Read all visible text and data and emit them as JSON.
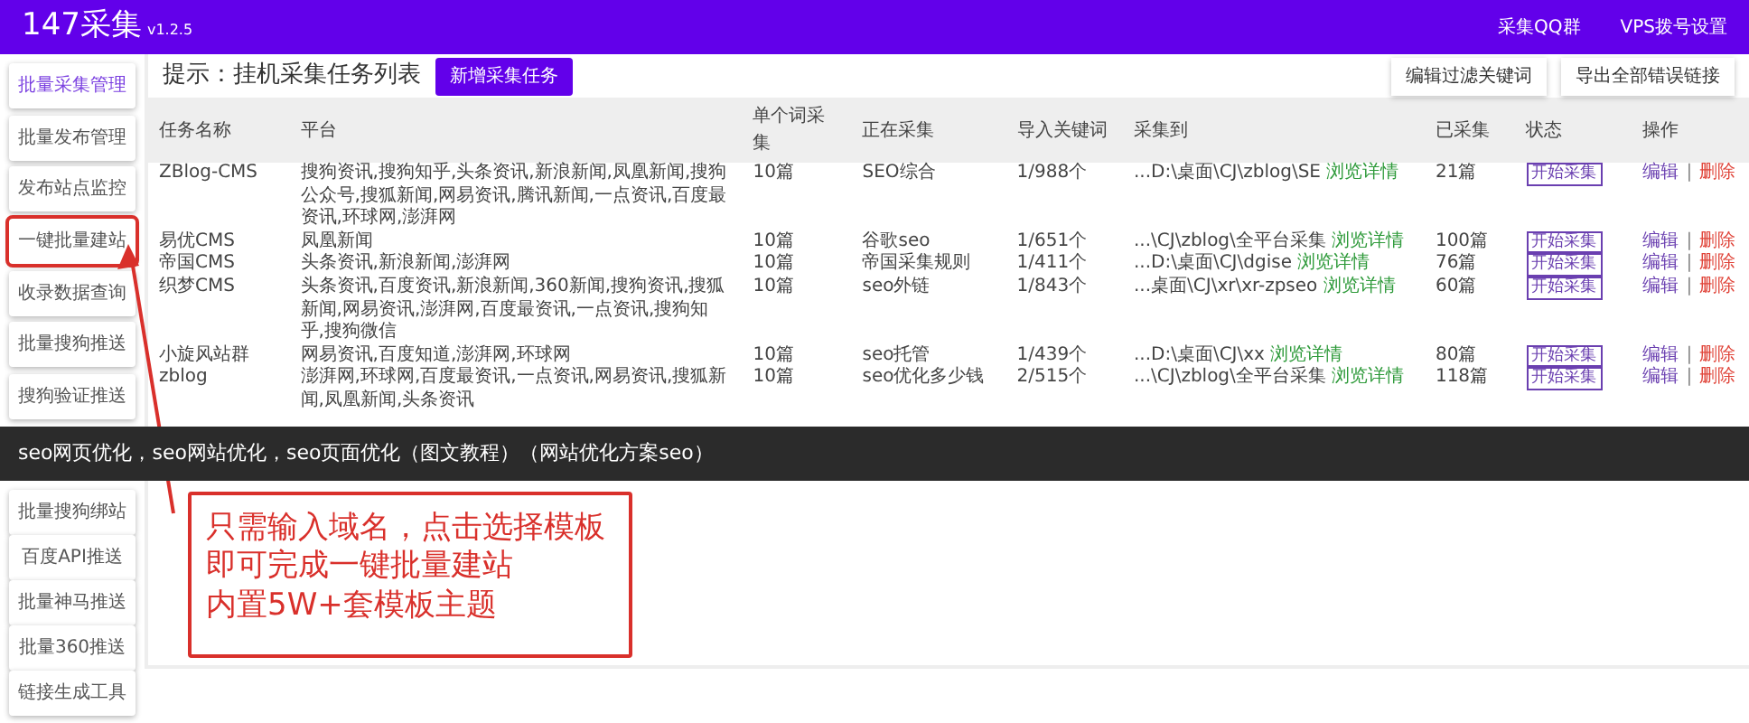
{
  "header": {
    "title": "147采集",
    "version": "v1.2.5",
    "links": [
      "采集QQ群",
      "VPS拨号设置"
    ]
  },
  "sidebar": {
    "top_items": [
      {
        "label": "批量采集管理",
        "selected": true,
        "annotated": false
      },
      {
        "label": "批量发布管理",
        "selected": false,
        "annotated": false
      },
      {
        "label": "发布站点监控",
        "selected": false,
        "annotated": false
      },
      {
        "label": "一键批量建站",
        "selected": false,
        "annotated": true
      },
      {
        "label": "收录数据查询",
        "selected": false,
        "annotated": false
      },
      {
        "label": "批量搜狗推送",
        "selected": false,
        "annotated": false
      },
      {
        "label": "搜狗验证推送",
        "selected": false,
        "annotated": false
      }
    ],
    "bottom_items": [
      {
        "label": "批量搜狗绑站",
        "selected": false,
        "annotated": false
      },
      {
        "label": "百度API推送",
        "selected": false,
        "annotated": false
      },
      {
        "label": "批量神马推送",
        "selected": false,
        "annotated": false
      },
      {
        "label": "批量360推送",
        "selected": false,
        "annotated": false
      },
      {
        "label": "链接生成工具",
        "selected": false,
        "annotated": false
      }
    ]
  },
  "toolbar": {
    "hint": "提示：挂机采集任务列表",
    "add_button": "新增采集任务",
    "buttons": [
      "编辑过滤关键词",
      "导出全部错误链接"
    ]
  },
  "table": {
    "columns": [
      "任务名称",
      "平台",
      "单个词采集",
      "正在采集",
      "导入关键词",
      "采集到",
      "已采集",
      "状态",
      "操作"
    ],
    "rows": [
      {
        "name": "ZBlog-CMS",
        "platforms": "搜狗资讯,搜狗知乎,头条资讯,新浪新闻,凤凰新闻,搜狗公众号,搜狐新闻,网易资讯,腾讯新闻,一点资讯,百度最资讯,环球网,澎湃网",
        "per_keyword": "10篇",
        "collecting": "SEO综合",
        "keywords": "1/988个",
        "path": "...D:\\桌面\\CJ\\zblog\\SE",
        "details": "浏览详情",
        "collected": "21篇",
        "status": "开始采集",
        "actions": [
          "编辑",
          "删除"
        ],
        "separator": "|"
      },
      {
        "name": "易优CMS",
        "platforms": "凤凰新闻",
        "per_keyword": "10篇",
        "collecting": "谷歌seo",
        "keywords": "1/651个",
        "path": "...\\CJ\\zblog\\全平台采集",
        "details": "浏览详情",
        "collected": "100篇",
        "status": "开始采集",
        "actions": [
          "编辑",
          "删除"
        ],
        "separator": "|"
      },
      {
        "name": "帝国CMS",
        "platforms": "头条资讯,新浪新闻,澎湃网",
        "per_keyword": "10篇",
        "collecting": "帝国采集规则",
        "keywords": "1/411个",
        "path": "...D:\\桌面\\CJ\\dgise",
        "details": "浏览详情",
        "collected": "76篇",
        "status": "开始采集",
        "actions": [
          "编辑",
          "删除"
        ],
        "separator": "|"
      },
      {
        "name": "织梦CMS",
        "platforms": "头条资讯,百度资讯,新浪新闻,360新闻,搜狗资讯,搜狐新闻,网易资讯,澎湃网,百度最资讯,一点资讯,搜狗知乎,搜狗微信",
        "per_keyword": "10篇",
        "collecting": "seo外链",
        "keywords": "1/843个",
        "path": "...桌面\\CJ\\xr\\xr-zpseo",
        "details": "浏览详情",
        "collected": "60篇",
        "status": "开始采集",
        "actions": [
          "编辑",
          "删除"
        ],
        "separator": "|"
      },
      {
        "name": "小旋风站群",
        "platforms": "网易资讯,百度知道,澎湃网,环球网",
        "per_keyword": "10篇",
        "collecting": "seo托管",
        "keywords": "1/439个",
        "path": "...D:\\桌面\\CJ\\xx",
        "details": "浏览详情",
        "collected": "80篇",
        "status": "开始采集",
        "actions": [
          "编辑",
          "删除"
        ],
        "separator": "|"
      },
      {
        "name": "zblog",
        "platforms": "澎湃网,环球网,百度最资讯,一点资讯,网易资讯,搜狐新闻,凤凰新闻,头条资讯",
        "per_keyword": "10篇",
        "collecting": "seo优化多少钱",
        "keywords": "2/515个",
        "path": "...\\CJ\\zblog\\全平台采集",
        "details": "浏览详情",
        "collected": "118篇",
        "status": "开始采集",
        "actions": [
          "编辑",
          "删除"
        ],
        "separator": "|"
      }
    ]
  },
  "banner": {
    "text": "seo网页优化，seo网站优化，seo页面优化（图文教程）（网站优化方案seo）"
  },
  "callout": {
    "lines": [
      "只需输入域名，点击选择模板",
      "即可完成一键批量建站",
      "内置5W+套模板主题"
    ]
  }
}
